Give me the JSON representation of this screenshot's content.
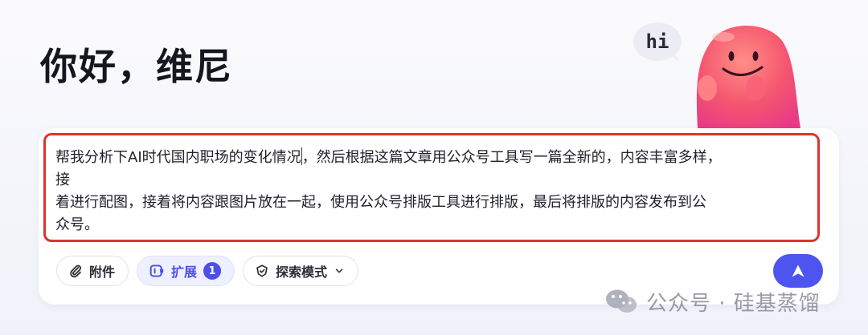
{
  "greeting": "你好，维尼",
  "mascot": {
    "bubble_text": "hi",
    "body_color": "#f24b73"
  },
  "prompt": {
    "lines": [
      "帮我分析下AI时代国内职场的变化情况",
      "，然后根据这篇文章用公众号工具写一篇全新的，内容丰富多样，",
      "接",
      "着进行配图，接着将内容跟图片放在一起，使用公众号排版工具进行排版，最后将排版的内容发布到公",
      "众号。"
    ],
    "highlight_color": "#e0322f"
  },
  "toolbar": {
    "attachment_label": "附件",
    "attachment_icon": "paperclip-icon",
    "extension_label": "扩展",
    "extension_icon": "plugin-icon",
    "extension_count": "1",
    "explore_label": "探索模式",
    "explore_icon": "shield-icon",
    "accent_color": "#4e54f0"
  },
  "send_icon": "send-arrow-icon",
  "watermark": {
    "icon": "wechat-icon",
    "text": "公众号 · 硅基蒸馏"
  }
}
